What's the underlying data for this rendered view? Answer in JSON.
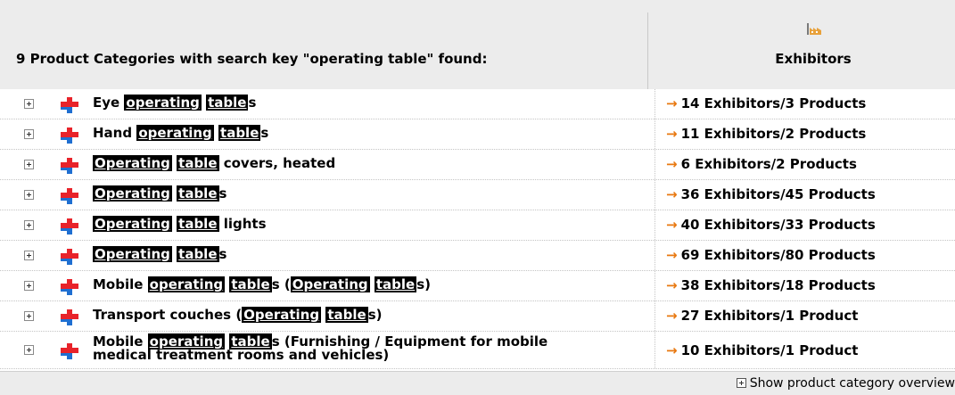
{
  "header": {
    "title": "9 Product Categories with search key \"operating table\" found:",
    "exhibitors_label": "Exhibitors",
    "exhibitors_icon": "factory-icon"
  },
  "rows": [
    {
      "segments": [
        [
          "Eye ",
          false
        ],
        [
          "operating",
          true
        ],
        [
          " ",
          false
        ],
        [
          "table",
          true
        ],
        [
          "s",
          false
        ]
      ],
      "exhibitors": "14 Exhibitors/3 Products"
    },
    {
      "segments": [
        [
          "Hand ",
          false
        ],
        [
          "operating",
          true
        ],
        [
          " ",
          false
        ],
        [
          "table",
          true
        ],
        [
          "s",
          false
        ]
      ],
      "exhibitors": "11 Exhibitors/2 Products"
    },
    {
      "segments": [
        [
          "Operating",
          true
        ],
        [
          " ",
          false
        ],
        [
          "table",
          true
        ],
        [
          " covers, heated",
          false
        ]
      ],
      "exhibitors": "6 Exhibitors/2 Products"
    },
    {
      "segments": [
        [
          "Operating",
          true
        ],
        [
          " ",
          false
        ],
        [
          "table",
          true
        ],
        [
          "s",
          false
        ]
      ],
      "exhibitors": "36 Exhibitors/45 Products"
    },
    {
      "segments": [
        [
          "Operating",
          true
        ],
        [
          " ",
          false
        ],
        [
          "table",
          true
        ],
        [
          " lights",
          false
        ]
      ],
      "exhibitors": "40 Exhibitors/33 Products"
    },
    {
      "segments": [
        [
          "Operating",
          true
        ],
        [
          " ",
          false
        ],
        [
          "table",
          true
        ],
        [
          "s",
          false
        ]
      ],
      "exhibitors": "69 Exhibitors/80 Products"
    },
    {
      "segments": [
        [
          "Mobile ",
          false
        ],
        [
          "operating",
          true
        ],
        [
          " ",
          false
        ],
        [
          "table",
          true
        ],
        [
          "s (",
          false
        ],
        [
          "Operating",
          true
        ],
        [
          " ",
          false
        ],
        [
          "table",
          true
        ],
        [
          "s)",
          false
        ]
      ],
      "exhibitors": "38 Exhibitors/18 Products"
    },
    {
      "segments": [
        [
          "Transport couches (",
          false
        ],
        [
          "Operating",
          true
        ],
        [
          " ",
          false
        ],
        [
          "table",
          true
        ],
        [
          "s)",
          false
        ]
      ],
      "exhibitors": "27 Exhibitors/1 Product"
    },
    {
      "segments": [
        [
          "Mobile ",
          false
        ],
        [
          "operating",
          true
        ],
        [
          " ",
          false
        ],
        [
          "table",
          true
        ],
        [
          "s (Furnishing / Equipment for mobile",
          false
        ]
      ],
      "line2": "medical treatment rooms and vehicles)",
      "exhibitors": "10 Exhibitors/1 Product"
    }
  ],
  "icons": {
    "expander": "expand-plus-icon",
    "category": "medical-cross-icon",
    "link_arrow": "arrow-right-icon"
  },
  "colors": {
    "header_bg": "#ececec",
    "highlight_bg": "#000000",
    "highlight_fg": "#ffffff",
    "arrow": "#e87810",
    "cross_red": "#e8232a",
    "cross_blue": "#1f6fd1"
  },
  "footer": {
    "label": "Show product category overview"
  }
}
